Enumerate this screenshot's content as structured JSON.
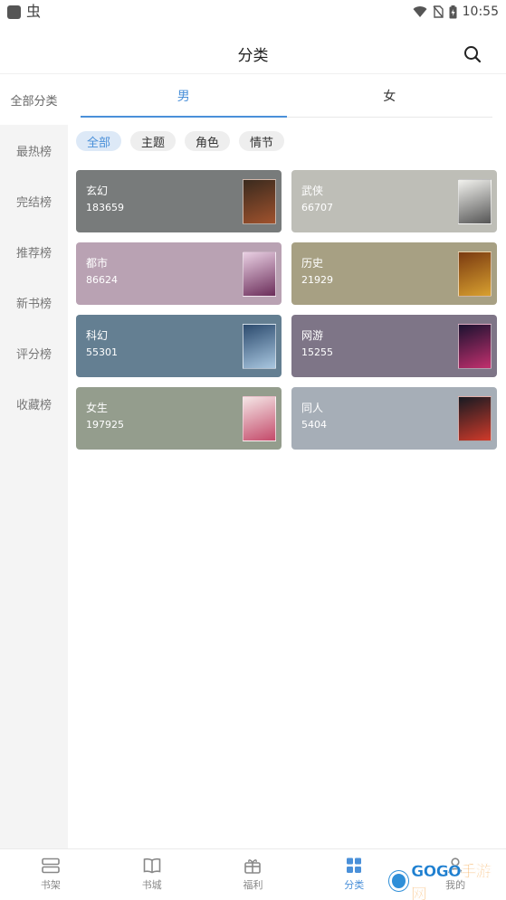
{
  "status_bar": {
    "time": "10:55",
    "bug_glyph": "虫"
  },
  "header": {
    "title": "分类"
  },
  "sidebar": {
    "items": [
      {
        "label": "全部分类",
        "active": true
      },
      {
        "label": "最热榜"
      },
      {
        "label": "完结榜"
      },
      {
        "label": "推荐榜"
      },
      {
        "label": "新书榜"
      },
      {
        "label": "评分榜"
      },
      {
        "label": "收藏榜"
      }
    ]
  },
  "gender_tabs": [
    {
      "label": "男",
      "active": true
    },
    {
      "label": "女"
    }
  ],
  "filters": [
    {
      "label": "全部",
      "active": true
    },
    {
      "label": "主题"
    },
    {
      "label": "角色"
    },
    {
      "label": "情节"
    }
  ],
  "categories": [
    {
      "name": "玄幻",
      "count": "183659",
      "color": "#787b7b",
      "cover_colors": [
        "#3a2a1e",
        "#a0522d"
      ]
    },
    {
      "name": "武侠",
      "count": "66707",
      "color": "#bebeb7",
      "cover_colors": [
        "#f2f2ee",
        "#555555"
      ]
    },
    {
      "name": "都市",
      "count": "86624",
      "color": "#b9a2b3",
      "cover_colors": [
        "#e9d0e3",
        "#6b2d5a"
      ]
    },
    {
      "name": "历史",
      "count": "21929",
      "color": "#a7a083",
      "cover_colors": [
        "#7a3a10",
        "#d8a030"
      ]
    },
    {
      "name": "科幻",
      "count": "55301",
      "color": "#647f92",
      "cover_colors": [
        "#2c4b6e",
        "#a9c7e0"
      ]
    },
    {
      "name": "网游",
      "count": "15255",
      "color": "#7e7587",
      "cover_colors": [
        "#1b1230",
        "#c2306e"
      ]
    },
    {
      "name": "女生",
      "count": "197925",
      "color": "#949d8d",
      "cover_colors": [
        "#f4e6e6",
        "#c44a6a"
      ]
    },
    {
      "name": "同人",
      "count": "5404",
      "color": "#a6aeb7",
      "cover_colors": [
        "#161a22",
        "#d03a2a"
      ]
    }
  ],
  "bottom_nav": [
    {
      "label": "书架",
      "icon": "bookshelf-icon"
    },
    {
      "label": "书城",
      "icon": "open-book-icon"
    },
    {
      "label": "福利",
      "icon": "gift-icon"
    },
    {
      "label": "分类",
      "icon": "grid-icon",
      "active": true
    },
    {
      "label": "我的",
      "icon": "user-icon"
    }
  ],
  "watermark": {
    "text_blue": "GOGO",
    "text_orange": "手游网"
  },
  "colors": {
    "accent": "#4a90d9",
    "sidebar_bg": "#f4f4f4"
  }
}
